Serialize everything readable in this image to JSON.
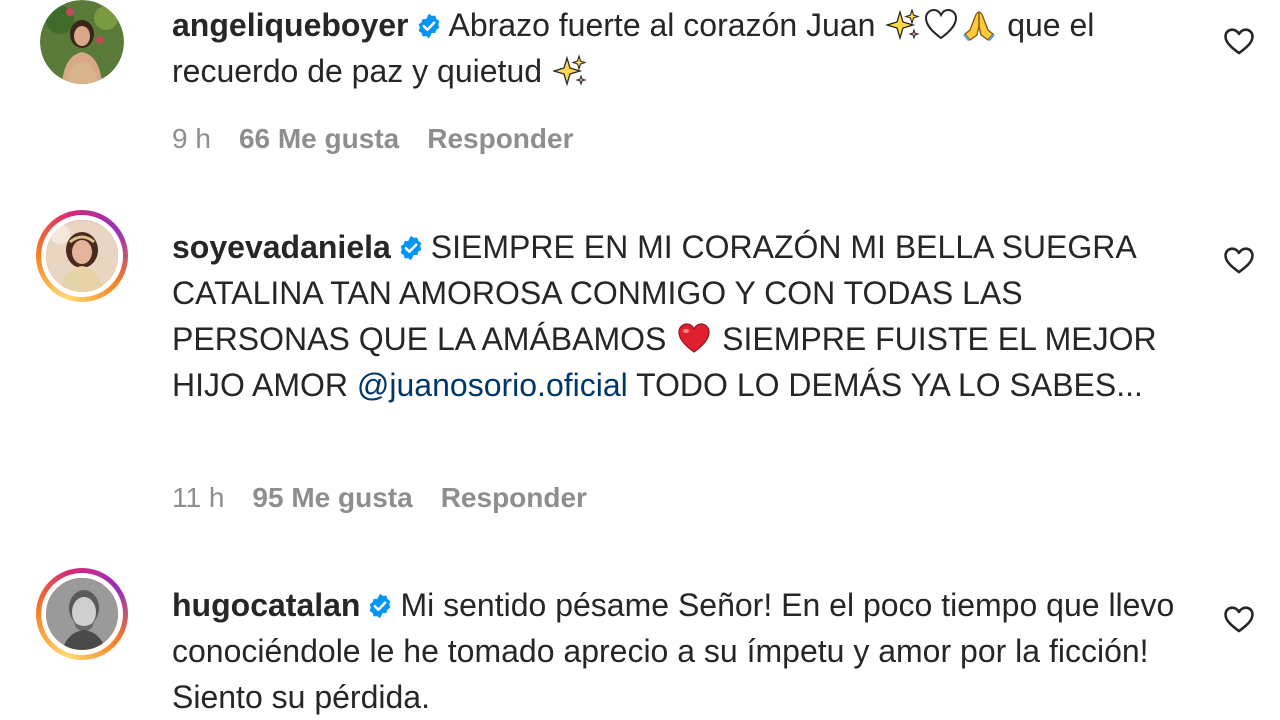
{
  "comments": [
    {
      "username": "angeliqueboyer",
      "verified": true,
      "text_parts": [
        "Abrazo fuerte al corazón Juan",
        "que el recuerdo de paz y quietud"
      ],
      "emojis": [
        "sparkles-emoji",
        "white-heart-emoji",
        "praying-hands-emoji",
        "sparkles-emoji"
      ],
      "time": "9 h",
      "likes": "66 Me gusta",
      "reply": "Responder"
    },
    {
      "username": "soyevadaniela",
      "verified": true,
      "text_before": "SIEMPRE EN MI CORAZÓN MI BELLA SUEGRA CATALINA TAN AMOROSA CONMIGO Y CON TODAS LAS PERSONAS QUE LA AMÁBAMOS",
      "text_middle": "SIEMPRE FUISTE EL MEJOR HIJO AMOR",
      "mention": "@juanosorio.oficial",
      "text_after": "TODO LO DEMÁS YA LO SABES...",
      "emojis": [
        "red-heart-emoji"
      ],
      "time": "11 h",
      "likes": "95 Me gusta",
      "reply": "Responder"
    },
    {
      "username": "hugocatalan",
      "verified": true,
      "text": "Mi sentido pésame Señor! En el poco tiempo que llevo conociéndole le he tomado aprecio a su ímpetu y amor por la ficción! Siento su pérdida."
    }
  ],
  "icons": {
    "verified": "verified-badge-icon",
    "like": "heart-outline-icon"
  },
  "colors": {
    "verified_blue": "#0095f6",
    "mention_blue": "#00376b",
    "meta_gray": "#8e8e8e"
  }
}
